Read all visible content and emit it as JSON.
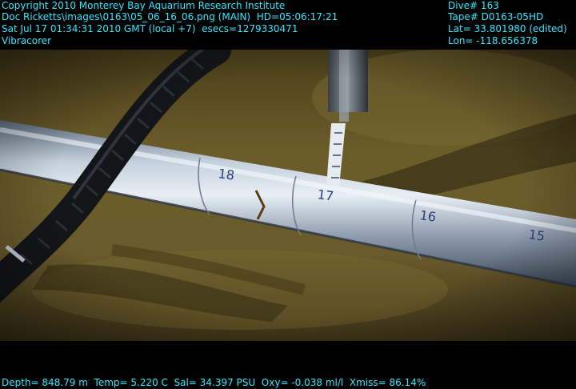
{
  "overlay": {
    "line1_left": "Copyright 2010 Monterey Bay Aquarium Research Institute",
    "line2_left": "Doc Ricketts\\images\\0163\\05_06_16_06.png (MAIN)  HD=05:06:17:21",
    "line3_left": "Sat Jul 17 01:34:31 2010 GMT (local +7)  esecs=1279330471",
    "line4_left": "Vibracorer",
    "line1_right": "Dive# 163",
    "line2_right": "Tape# D0163-05HD",
    "line3_right": "Lat= 33.801980 (edited)",
    "line4_right": "Lon= -118.656378",
    "bottom": "Depth= 848.79 m  Temp= 5.220 C  Sal= 34.397 PSU  Oxy= -0.038 ml/l  Xmiss= 86.14%",
    "color": "#33e6ff"
  },
  "scene": {
    "pipe_marks": [
      "18",
      "17",
      "16",
      "15"
    ]
  }
}
